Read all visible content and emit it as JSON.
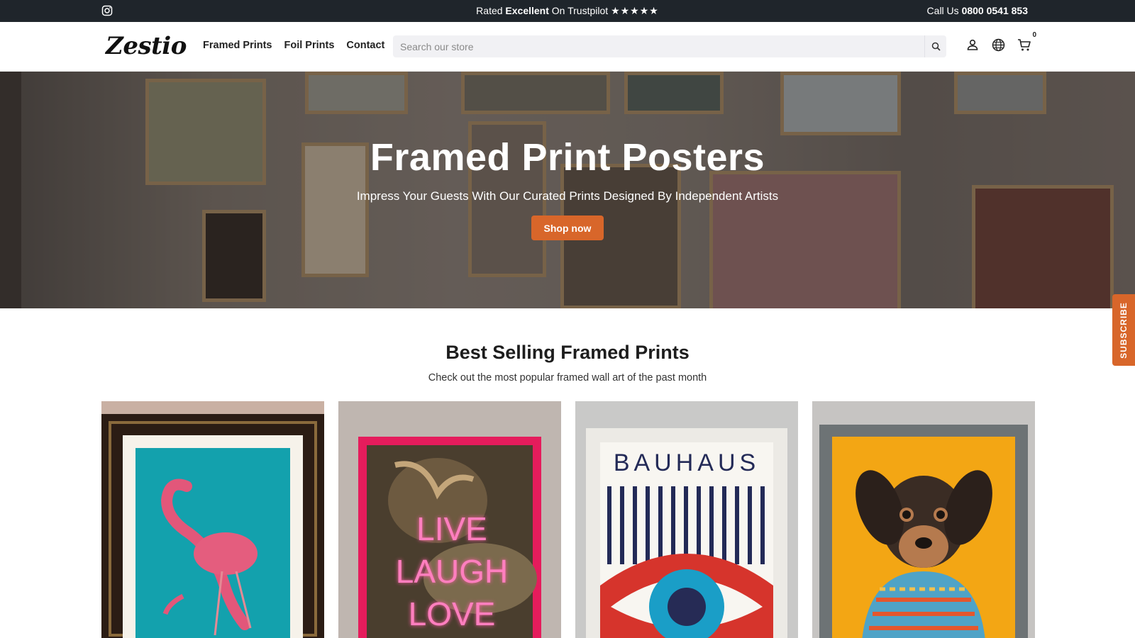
{
  "topbar": {
    "rated_prefix": "Rated",
    "rated_word": "Excellent",
    "rated_suffix": "On Trustpilot",
    "stars": "★★★★★",
    "call_prefix": "Call Us",
    "phone": "0800 0541 853"
  },
  "header": {
    "logo": "Zestio",
    "nav": [
      "Framed Prints",
      "Foil Prints",
      "Contact"
    ],
    "search_placeholder": "Search our store",
    "cart_count": "0"
  },
  "hero": {
    "title": "Framed Print Posters",
    "subtitle": "Impress Your Guests With Our Curated Prints Designed By Independent Artists",
    "cta": "Shop now"
  },
  "section": {
    "title": "Best Selling Framed Prints",
    "subtitle": "Check out the most popular framed wall art of the past month"
  },
  "products": [
    {
      "name": "flamingo-print",
      "art_text": ""
    },
    {
      "name": "live-laugh-love-print",
      "art_text": "LIVE LAUGH LOVE"
    },
    {
      "name": "bauhaus-eye-print",
      "art_text": "BAUHAUS"
    },
    {
      "name": "dog-sweater-print",
      "art_text": ""
    }
  ],
  "subscribe": {
    "label": "SUBSCRIBE"
  },
  "colors": {
    "accent": "#d8662a",
    "topbar": "#1f252b"
  }
}
